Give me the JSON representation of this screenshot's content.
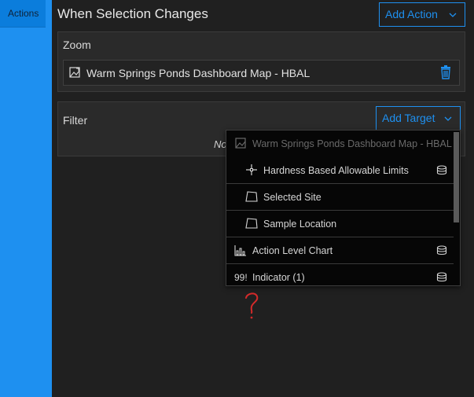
{
  "sidebar": {
    "tab_label": "Actions"
  },
  "header": {
    "title": "When Selection Changes",
    "add_action_label": "Add Action"
  },
  "zoom": {
    "title": "Zoom",
    "item": {
      "label": "Warm Springs Ponds Dashboard Map - HBAL",
      "icon": "map-icon",
      "delete_icon": "trash-icon"
    }
  },
  "filter": {
    "title": "Filter",
    "add_target_label": "Add Target",
    "note": "No"
  },
  "dropdown": {
    "items": [
      {
        "label": "Warm Springs Ponds Dashboard Map - HBAL",
        "icon": "map-icon",
        "disabled": true,
        "indent": 0,
        "datasource": false
      },
      {
        "label": "Hardness Based Allowable Limits",
        "icon": "point-layer-icon",
        "disabled": false,
        "indent": 1,
        "datasource": true
      },
      {
        "label": "Selected Site",
        "icon": "polygon-layer-icon",
        "disabled": false,
        "indent": 1,
        "datasource": false
      },
      {
        "label": "Sample Location",
        "icon": "polygon-layer-icon",
        "disabled": false,
        "indent": 1,
        "datasource": false
      },
      {
        "label": "Action Level Chart",
        "icon": "chart-icon",
        "disabled": false,
        "indent": 0,
        "datasource": true
      },
      {
        "label": "Indicator (1)",
        "icon": "indicator-icon",
        "icon_text": "99!",
        "disabled": false,
        "indent": 0,
        "datasource": true
      }
    ]
  },
  "annotation": {
    "mark": "?",
    "color": "#d42a2a"
  },
  "colors": {
    "accent": "#1e90f0",
    "panel": "#2a2a2a",
    "background": "#202020"
  }
}
